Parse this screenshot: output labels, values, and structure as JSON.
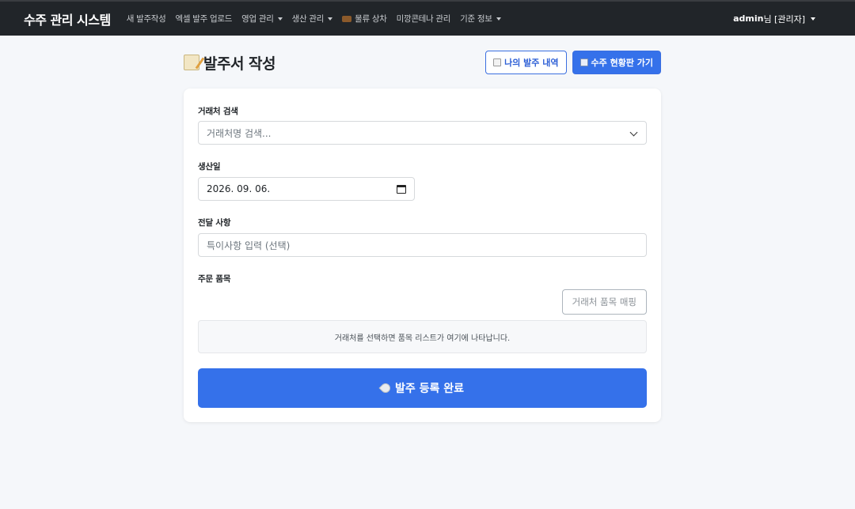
{
  "navbar": {
    "brand": "수주 관리 시스템",
    "items": [
      {
        "label": "새 발주작성",
        "dropdown": false
      },
      {
        "label": "엑셀 발주 업로드",
        "dropdown": false
      },
      {
        "label": "영업 관리",
        "dropdown": true
      },
      {
        "label": "생산 관리",
        "dropdown": true
      },
      {
        "label": "물류 상차",
        "dropdown": false,
        "icon": "truck-icon"
      },
      {
        "label": "미깡콘테나 관리",
        "dropdown": false
      },
      {
        "label": "기준 정보",
        "dropdown": true
      }
    ],
    "user": {
      "name": "admin",
      "suffix": "님 [관리자]"
    }
  },
  "header": {
    "title": "발주서 작성",
    "title_icon": "memo-icon",
    "my_orders_label": "나의 발주 내역",
    "dashboard_label": "수주 현황판 가기"
  },
  "form": {
    "client_label": "거래처 검색",
    "client_placeholder": "거래처명 검색...",
    "date_label": "생산일",
    "date_value": "2026. 09. 06.",
    "note_label": "전달 사항",
    "note_placeholder": "특이사항 입력 (선택)",
    "items_label": "주문 품목",
    "map_button_label": "거래처 품목 매핑",
    "items_empty_message": "거래처를 선택하면 품목 리스트가 여기에 나타납니다.",
    "submit_label": "발주 등록 완료"
  },
  "colors": {
    "navbar_bg": "#212529",
    "primary": "#3571ea",
    "page_bg": "#f5f7fa"
  }
}
